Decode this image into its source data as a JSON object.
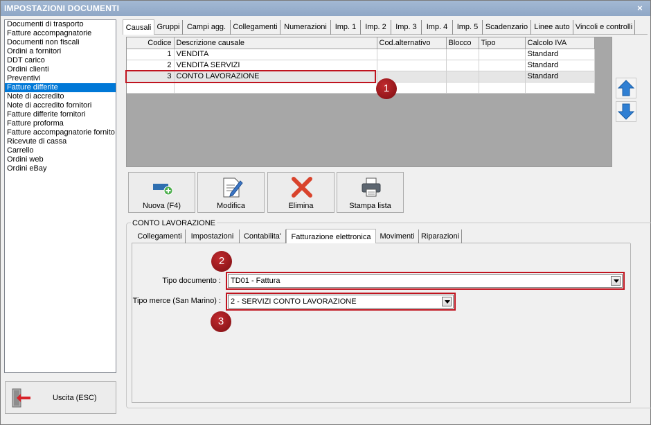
{
  "window": {
    "title": "IMPOSTAZIONI DOCUMENTI",
    "close": "×"
  },
  "sidebar": {
    "items": [
      "Documenti di trasporto",
      "Fatture accompagnatorie",
      "Documenti non fiscali",
      "Ordini a fornitori",
      "DDT carico",
      "Ordini clienti",
      "Preventivi",
      "Fatture differite",
      "Note di accredito",
      "Note di accredito fornitori",
      "Fatture differite fornitori",
      "Fatture proforma",
      "Fatture accompagnatorie fornito",
      "Ricevute di cassa",
      "Carrello",
      "Ordini web",
      "Ordini eBay"
    ],
    "selected": "Fatture differite"
  },
  "exit_button": {
    "label": "Uscita (ESC)"
  },
  "top_tabs": [
    "Causali",
    "Gruppi",
    "Campi agg.",
    "Collegamenti",
    "Numerazioni",
    "Imp. 1",
    "Imp. 2",
    "Imp. 3",
    "Imp. 4",
    "Imp. 5",
    "Scadenzario",
    "Linee auto",
    "Vincoli e controlli"
  ],
  "grid": {
    "columns": [
      "Codice",
      "Descrizione causale",
      "Cod.alternativo",
      "Blocco",
      "Tipo",
      "Calcolo IVA"
    ],
    "rows": [
      [
        "1",
        "VENDITA",
        "",
        "",
        "",
        "Standard"
      ],
      [
        "2",
        "VENDITA SERVIZI",
        "",
        "",
        "",
        "Standard"
      ],
      [
        "3",
        "CONTO LAVORAZIONE",
        "",
        "",
        "",
        "Standard"
      ]
    ]
  },
  "toolbar": {
    "new_label": "Nuova (F4)",
    "edit_label": "Modifica",
    "delete_label": "Elimina",
    "print_label": "Stampa lista"
  },
  "detail": {
    "group_title": "CONTO LAVORAZIONE",
    "tabs": [
      "Collegamenti",
      "Impostazioni",
      "Contabilita'",
      "Fatturazione elettronica",
      "Movimenti",
      "Riparazioni"
    ],
    "tipo_documento_label": "Tipo documento :",
    "tipo_documento_value": "TD01 - Fattura",
    "tipo_merce_label": "Tipo merce (San Marino) :",
    "tipo_merce_value": "2 - SERVIZI CONTO LAVORAZIONE"
  },
  "badges": [
    "1",
    "2",
    "3"
  ],
  "colors": {
    "highlight": "#c0141f",
    "selection": "#0078d7",
    "badge": "#9a1a1e"
  }
}
